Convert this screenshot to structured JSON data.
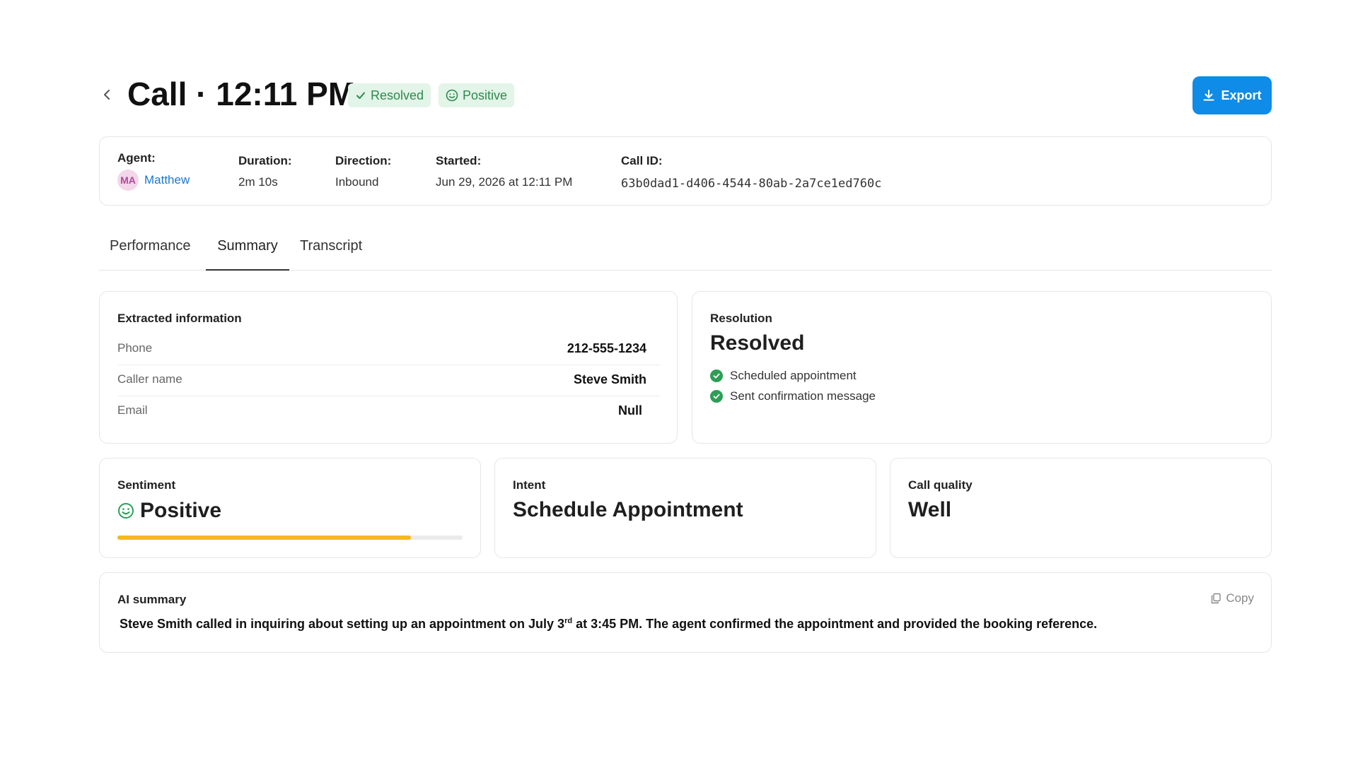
{
  "header": {
    "title": "Call · 12:11 PM",
    "badges": {
      "resolved": "Resolved",
      "positive": "Positive"
    },
    "export_label": "Export"
  },
  "info": {
    "agent": {
      "label": "Agent:",
      "initials": "MA",
      "name": "Matthew"
    },
    "duration": {
      "label": "Duration:",
      "value": "2m 10s"
    },
    "direction": {
      "label": "Direction:",
      "value": "Inbound"
    },
    "started": {
      "label": "Started:",
      "value": "Jun 29, 2026 at 12:11 PM"
    },
    "call_id": {
      "label": "Call ID:",
      "value": "63b0dad1-d406-4544-80ab-2a7ce1ed760c"
    }
  },
  "tabs": [
    {
      "label": "Performance",
      "active": false
    },
    {
      "label": "Summary",
      "active": true
    },
    {
      "label": "Transcript",
      "active": false
    }
  ],
  "extracted": {
    "title": "Extracted information",
    "rows": [
      {
        "key": "Phone",
        "value": "212-555-1234"
      },
      {
        "key": "Caller name",
        "value": "Steve Smith"
      },
      {
        "key": "Email",
        "value": "Null"
      }
    ]
  },
  "resolution": {
    "title": "Resolution",
    "status": "Resolved",
    "items": [
      "Scheduled appointment",
      "Sent confirmation message"
    ]
  },
  "sentiment": {
    "title": "Sentiment",
    "value": "Positive",
    "score": 0.85
  },
  "intent": {
    "title": "Intent",
    "value": "Schedule Appointment"
  },
  "quality": {
    "title": "Call quality",
    "value": "Well"
  },
  "summary": {
    "title": "AI summary",
    "copy_label": "Copy",
    "text_before": "Steve Smith called in inquiring about setting up an appointment on July 3",
    "text_sup": "rd",
    "text_after": " at 3:45 PM. The agent confirmed the appointment and provided the booking reference."
  },
  "colors": {
    "accent": "#0f8be8",
    "badge_bg": "#e3f4e8",
    "badge_text": "#2e8a4f",
    "progress": "#f4b820",
    "check": "#2e9e57",
    "agent_link": "#1a78d0"
  },
  "icons": {
    "back": "chevron-left-icon",
    "resolved_badge": "check-icon",
    "positive_badge": "smile-icon",
    "export": "download-icon",
    "resolution_items": "check-circle-icon",
    "sentiment": "smile-icon",
    "copy": "copy-icon"
  }
}
